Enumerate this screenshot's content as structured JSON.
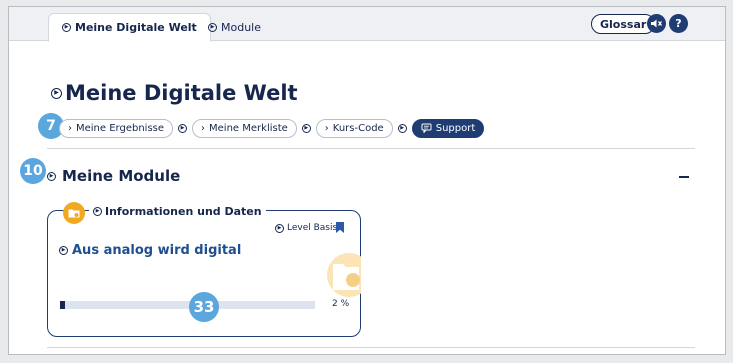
{
  "tabs": [
    {
      "label": "Meine Digitale Welt",
      "active": true
    },
    {
      "label": "Module",
      "active": false
    }
  ],
  "header": {
    "glossar_label": "Glossar",
    "sound_icon": "speaker-mute-icon",
    "help_icon": "question-icon",
    "help_glyph": "?"
  },
  "page": {
    "title": "Meine Digitale Welt"
  },
  "nav": {
    "items": [
      {
        "label": "Meine Ergebnisse",
        "prefix": "›"
      },
      {
        "label": "Meine Merkliste",
        "prefix": "›"
      },
      {
        "label": "Kurs-Code",
        "prefix": "›"
      },
      {
        "label": "Support",
        "icon": "chat-icon"
      }
    ]
  },
  "badges": {
    "nav": "7",
    "section": "10",
    "progress": "33"
  },
  "section": {
    "title": "Meine Module",
    "collapse_symbol": "–"
  },
  "module": {
    "category": "Informationen und Daten",
    "level": "Level Basis",
    "title": "Aus analog wird digital",
    "progress_percent": 2,
    "progress_label": "2 %"
  },
  "colors": {
    "navy": "#16264c",
    "accent_blue": "#1f3d73",
    "badge_blue": "#5ba6dd",
    "folder_orange": "#f2a922"
  }
}
